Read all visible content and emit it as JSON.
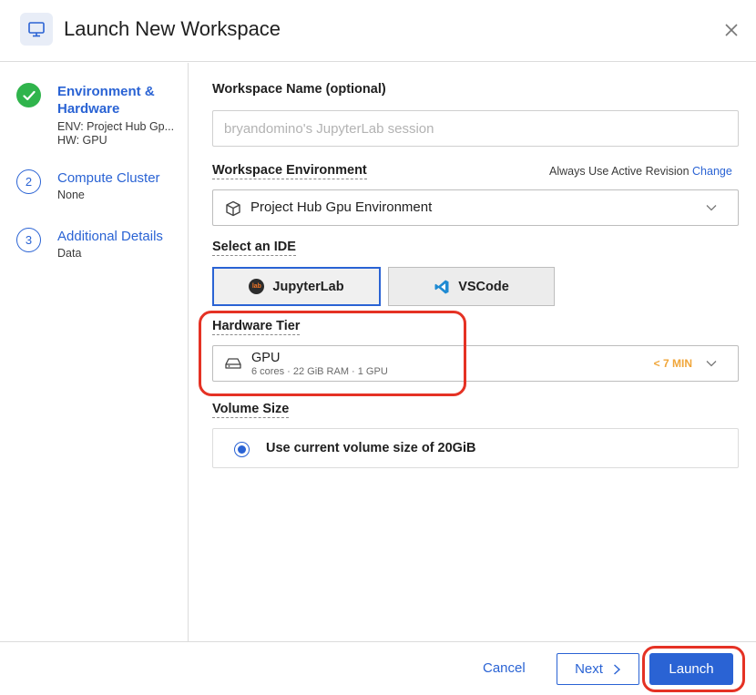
{
  "header": {
    "title": "Launch New Workspace",
    "icon": "monitor-icon"
  },
  "sidebar": {
    "steps": [
      {
        "title": "Environment & Hardware",
        "lines": [
          "ENV: Project Hub Gp...",
          "HW: GPU"
        ],
        "status": "complete"
      },
      {
        "number": "2",
        "title": "Compute Cluster",
        "lines": [
          "None"
        ],
        "status": "pending"
      },
      {
        "number": "3",
        "title": "Additional Details",
        "lines": [
          "Data"
        ],
        "status": "pending"
      }
    ]
  },
  "form": {
    "workspace_name": {
      "label": "Workspace Name (optional)",
      "placeholder": "bryandomino's JupyterLab session",
      "value": ""
    },
    "environment": {
      "label": "Workspace Environment",
      "revision_text": "Always Use Active Revision",
      "change_link": "Change",
      "selected": "Project Hub Gpu Environment"
    },
    "ide": {
      "label": "Select an IDE",
      "options": [
        {
          "label": "JupyterLab",
          "icon_text": "lab",
          "selected": true
        },
        {
          "label": "VSCode",
          "selected": false
        }
      ]
    },
    "hardware": {
      "label": "Hardware Tier",
      "name": "GPU",
      "specs": "6 cores · 22 GiB RAM · 1 GPU",
      "time": "< 7 MIN"
    },
    "volume": {
      "label": "Volume Size",
      "option": "Use current volume size of 20GiB",
      "selected": true
    }
  },
  "footer": {
    "cancel": "Cancel",
    "next": "Next",
    "launch": "Launch"
  },
  "colors": {
    "accent": "#2a63d4",
    "success": "#30b44c",
    "warning": "#f0a63a",
    "annotation": "#e53224"
  }
}
